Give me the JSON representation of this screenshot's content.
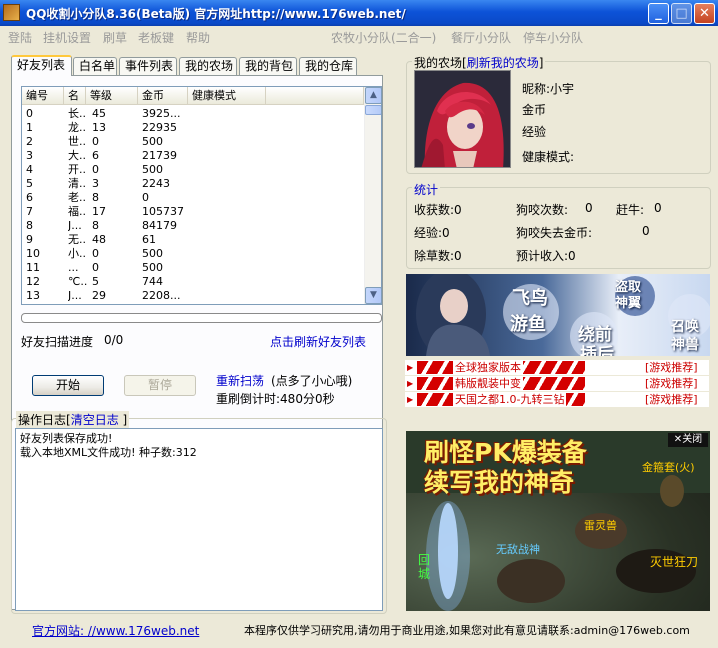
{
  "window": {
    "title": "QQ收割小分队8.36(Beta版) 官方网址http://www.176web.net/"
  },
  "menu": {
    "left": [
      "登陆",
      "挂机设置",
      "刷草",
      "老板键",
      "帮助"
    ],
    "right": [
      "农牧小分队(二合一)",
      "餐厅小分队",
      "停车小分队"
    ]
  },
  "tabs": [
    "好友列表",
    "白名单",
    "事件列表",
    "我的农场",
    "我的背包",
    "我的仓库"
  ],
  "friend_table": {
    "columns": [
      "编号",
      "名",
      "等级",
      "金币",
      "健康模式"
    ],
    "rows": [
      [
        "0",
        "长..",
        "45",
        "3925...",
        ""
      ],
      [
        "1",
        "龙..",
        "13",
        "22935",
        ""
      ],
      [
        "2",
        "世..",
        "0",
        "500",
        ""
      ],
      [
        "3",
        "大..",
        "6",
        "21739",
        ""
      ],
      [
        "4",
        "开..",
        "0",
        "500",
        ""
      ],
      [
        "5",
        "清..",
        "3",
        "2243",
        ""
      ],
      [
        "6",
        "老..",
        "8",
        "0",
        ""
      ],
      [
        "7",
        "福..",
        "17",
        "105737",
        ""
      ],
      [
        "8",
        "J...",
        "8",
        "84179",
        ""
      ],
      [
        "9",
        "无..",
        "48",
        "61",
        ""
      ],
      [
        "10",
        "小..",
        "0",
        "500",
        ""
      ],
      [
        "11",
        "...",
        "0",
        "500",
        ""
      ],
      [
        "12",
        "℃..",
        "5",
        "744",
        ""
      ],
      [
        "13",
        "J...",
        "29",
        "2208...",
        ""
      ]
    ]
  },
  "scan": {
    "progress_label": "好友扫描进度",
    "progress_value": "0/0",
    "progress_fraction": 0,
    "refresh_link": "点击刷新好友列表"
  },
  "controls": {
    "start_button": "开始",
    "pause_button": "暂停",
    "rescan_link": "重新扫荡",
    "rescan_hint": "(点多了小心哦)",
    "countdown": "重刷倒计时:480分0秒"
  },
  "log": {
    "header": "操作日志[",
    "clear_link": "清空日志",
    "header_end": "]",
    "lines": [
      "好友列表保存成功!",
      "载入本地XML文件成功! 种子数:312"
    ]
  },
  "farm": {
    "header": "我的农场[",
    "refresh_link": "刷新我的农场",
    "header_end": "]",
    "nickname": "昵称:小宇",
    "gold": "金币",
    "exp": "经验",
    "health": "健康模式:"
  },
  "stats": {
    "header": "统计",
    "harvest": "收获数:0",
    "dog_bites_label": "狗咬次数:",
    "dog_bites_value": "0",
    "chase_label": "赶牛:",
    "chase_value": "0",
    "exp": "经验:0",
    "dog_gold_label": "狗咬失去金币:",
    "dog_gold_value": "0",
    "weed": "除草数:0",
    "expected": "预计收入:0"
  },
  "ads": {
    "banner1_words": [
      "飞鸟",
      "游鱼",
      "盗取",
      "神翼",
      "绕前",
      "插后",
      "召唤",
      "神兽"
    ],
    "list": [
      {
        "text": "全球独家版本",
        "tag": "[游戏推荐]"
      },
      {
        "text": "韩版靓装中变",
        "tag": "[游戏推荐]"
      },
      {
        "text": "天国之都1.0-九转三钻",
        "tag": "[游戏推荐]"
      }
    ],
    "banner2_line1": "刷怪PK爆装备",
    "banner2_line2": "续写我的神奇",
    "banner2_close": "关闭",
    "banner2_labels": [
      "金箍套(火)",
      "雷灵兽",
      "无敌战神",
      "灭世狂刀",
      "回城"
    ]
  },
  "footer": {
    "site_link": "官方网站: //www.176web.net",
    "notice": "本程序仅供学习研究用,请勿用于商业用途,如果您对此有意见请联系:admin@176web.com"
  },
  "colors": {
    "titlebar": "#0a49c8",
    "accent_link": "#0000cc",
    "ad_red": "#cc0000",
    "tab_highlight": "#ffc83c"
  }
}
